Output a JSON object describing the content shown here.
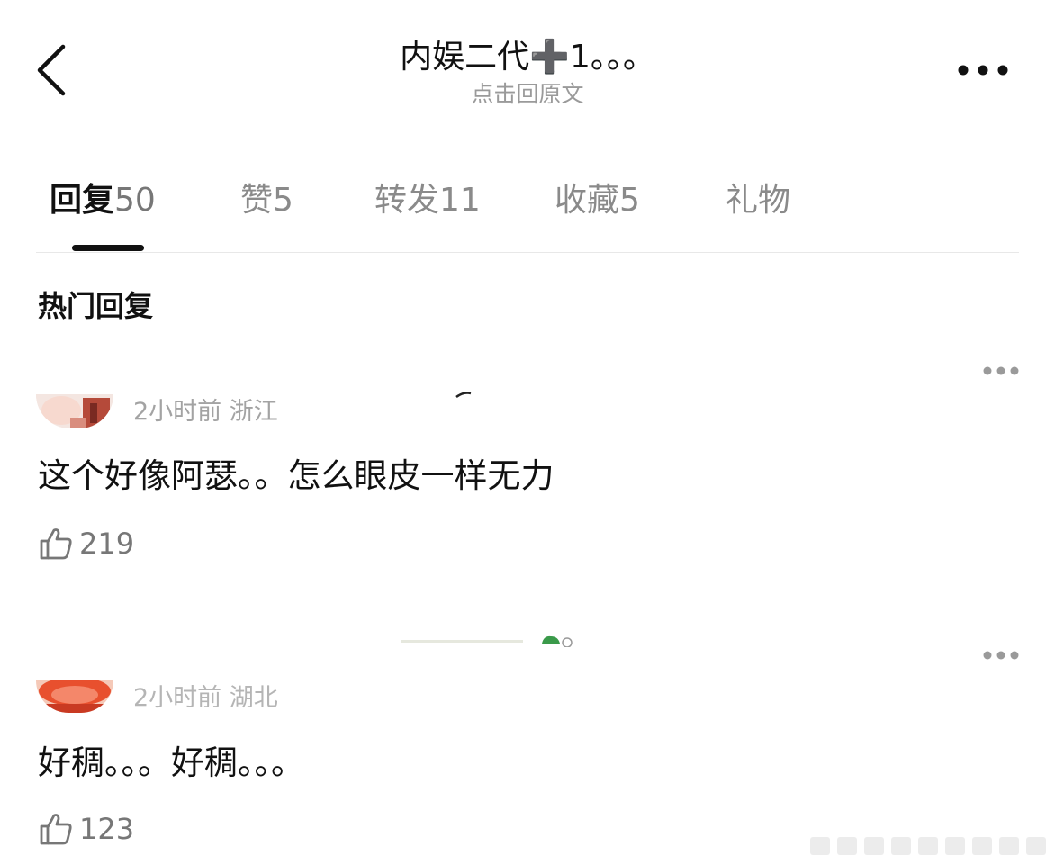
{
  "header": {
    "title": "内娱二代➕1。。。",
    "subtitle": "点击回原文",
    "back_icon": "chevron-left-icon",
    "more_icon": "more-horizontal-icon"
  },
  "tabs": [
    {
      "label": "回复",
      "count": "50",
      "active": true
    },
    {
      "label": "赞",
      "count": "5",
      "active": false
    },
    {
      "label": "转发",
      "count": "11",
      "active": false
    },
    {
      "label": "收藏",
      "count": "5",
      "active": false
    },
    {
      "label": "礼物",
      "count": "",
      "active": false
    }
  ],
  "section_title": "热门回复",
  "comments": [
    {
      "meta": "2小时前 浙江",
      "text": "这个好像阿瑟。。怎么眼皮一样无力",
      "likes": "219"
    },
    {
      "meta": "2小时前 湖北",
      "text": "好稠。。。好稠。。。",
      "likes": "123"
    }
  ],
  "colors": {
    "text_primary": "#111111",
    "text_secondary": "#9a9a9a",
    "divider": "#e8e8e8"
  }
}
